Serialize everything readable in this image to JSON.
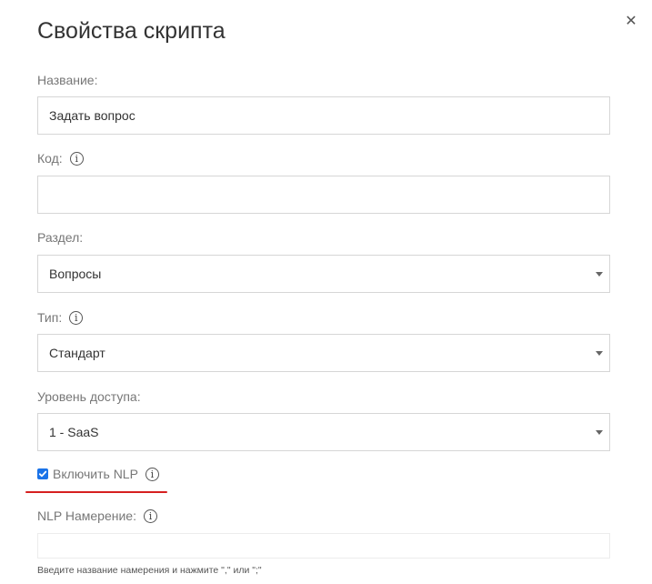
{
  "dialog": {
    "title": "Свойства скрипта",
    "close_icon": "close-icon"
  },
  "fields": {
    "name": {
      "label": "Название:",
      "value": "Задать вопрос"
    },
    "code": {
      "label": "Код:",
      "value": ""
    },
    "section": {
      "label": "Раздел:",
      "value": "Вопросы"
    },
    "type": {
      "label": "Тип:",
      "value": "Стандарт"
    },
    "access": {
      "label": "Уровень доступа:",
      "value": "1 - SaaS"
    }
  },
  "nlp": {
    "checkbox_label": "Включить NLP",
    "checked": true,
    "intent_label": "NLP Намерение:",
    "intent_value": "",
    "hint": "Введите название намерения и нажмите \",\" или \";\""
  },
  "colors": {
    "checkbox_accent": "#1a73e8",
    "highlight_underline": "#d62020"
  }
}
